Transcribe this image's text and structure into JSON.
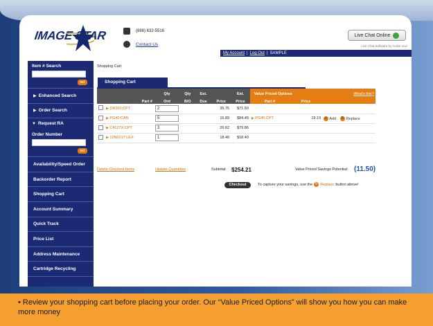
{
  "header": {
    "logo_text": "IMAGE STAR",
    "phone": "(888) 632-5516",
    "contact_link": "Contact Us",
    "chat_button": "Live Chat Online",
    "chat_sub": "Live Chat Software by Active Live",
    "my_account": "My Account",
    "separator": "|",
    "logout": "Log Out",
    "user": "SAMPLE"
  },
  "sidebar": {
    "item_search_title": "Item # Search",
    "go_label": "GO",
    "enhanced_search": "Enhanced Search",
    "order_search": "Order Search",
    "request_ra": "Request RA",
    "order_number": "Order Number",
    "items": [
      "Availability/Speed Order",
      "Backorder Report",
      "Shopping Cart",
      "Account Summary",
      "Quick Track",
      "Price List",
      "Address Maintenance",
      "Cartridge Recycling"
    ]
  },
  "breadcrumb": "Shopping Cart",
  "tab_label": "Shopping Cart",
  "table": {
    "headers": {
      "part": "Part #",
      "qty_ord_1": "Qty",
      "qty_ord_2": "Ord",
      "qty_bo_1": "Qty",
      "qty_bo_2": "B/O",
      "est_due_1": "Est.",
      "est_due_2": "Due",
      "price": "Price",
      "ext_price_1": "Ext.",
      "ext_price_2": "Price",
      "vpo_title": "Value Priced Options",
      "whats_this": "What's this?",
      "vpo_part": "Part #",
      "vpo_price": "Price"
    },
    "rows": [
      {
        "part": "DR350;CPT",
        "qty": "2",
        "price": "35.75",
        "ext": "$71.50",
        "vpo_part": "",
        "vpo_price": ""
      },
      {
        "part": "PG40;CAN",
        "qty": "5",
        "price": "16.89",
        "ext": "$84.45",
        "vpo_part": "PG40;CPT",
        "vpo_price": "19.19",
        "add": "Add",
        "replace": "Replace"
      },
      {
        "part": "C4127X;CPT",
        "qty": "3",
        "price": "26.62",
        "ext": "$79.86",
        "vpo_part": "",
        "vpo_price": ""
      },
      {
        "part": "10N0217;LEX",
        "qty": "1",
        "price": "18.40",
        "ext": "$18.40",
        "vpo_part": "",
        "vpo_price": ""
      }
    ]
  },
  "footer_links": {
    "delete": "Delete Checked Items",
    "update": "Update Quantities",
    "subtotal_label": "Subtotal:",
    "subtotal_value": "$254.21",
    "savings_label": "Value Priced Savings Potential:",
    "savings_value": "(11.50)",
    "checkout": "Checkout",
    "capture_pre": "To capture your savings, use the",
    "capture_replace": "Replace",
    "capture_post": "button above!"
  },
  "caption": "• Review your shopping cart before placing your order.  Our “Value Priced Options” will show you how you can make more money"
}
